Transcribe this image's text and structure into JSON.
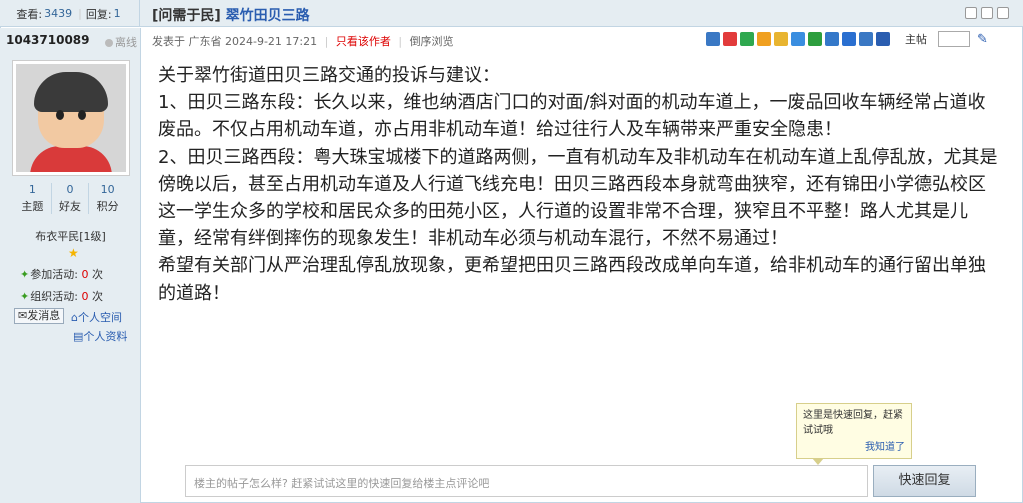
{
  "header": {
    "views_label": "查看:",
    "views": "3439",
    "replies_label": "回复:",
    "replies": "1",
    "category": "[问需于民]",
    "title": "翠竹田贝三路"
  },
  "author": {
    "name": "1043710089",
    "status": "离线",
    "posted_prefix": "发表于",
    "location": "广东省",
    "datetime": "2024-9-21 17:21",
    "only_author": "只看该作者",
    "reverse": "倒序浏览",
    "floor_label": "主帖"
  },
  "profile": {
    "stats": [
      {
        "value": "1",
        "label": "主题"
      },
      {
        "value": "0",
        "label": "好友"
      },
      {
        "value": "10",
        "label": "积分"
      }
    ],
    "rank": "布衣平民[1级]",
    "activities": [
      {
        "label": "参加活动:",
        "count": "0",
        "unit": "次"
      },
      {
        "label": "组织活动:",
        "count": "0",
        "unit": "次"
      }
    ],
    "send_msg": "发消息",
    "space": "个人空间",
    "profile_link": "个人资料"
  },
  "post": {
    "paragraphs": [
      "关于翠竹街道田贝三路交通的投诉与建议：",
      "1、田贝三路东段：长久以来，维也纳酒店门口的对面/斜对面的机动车道上，一废品回收车辆经常占道收废品。不仅占用机动车道，亦占用非机动车道！给过往行人及车辆带来严重安全隐患！",
      "2、田贝三路西段：粤大珠宝城楼下的道路两侧，一直有机动车及非机动车在机动车道上乱停乱放，尤其是傍晚以后，甚至占用机动车道及人行道飞线充电！田贝三路西段本身就弯曲狭窄，还有锦田小学德弘校区这一学生众多的学校和居民众多的田苑小区，人行道的设置非常不合理，狭窄且不平整！路人尤其是儿童，经常有绊倒摔伤的现象发生！非机动车必须与机动车混行，不然不易通过！",
      "希望有关部门从严治理乱停乱放现象，更希望把田贝三路西段改成单向车道，给非机动车的通行留出单独的道路！"
    ]
  },
  "tooltip": {
    "text": "这里是快速回复，赶紧试试哦",
    "ok": "我知道了"
  },
  "reply": {
    "placeholder": "楼主的帖子怎么样? 赶紧试试这里的快速回复给楼主点评论吧",
    "button": "快速回复"
  },
  "icons": {
    "header": [
      "print-icon",
      "prev-icon",
      "next-icon"
    ],
    "share": [
      "plus-icon",
      "weibo-icon",
      "wechat-icon",
      "qq-icon",
      "qzone-icon",
      "tencent-weibo-icon",
      "douban-icon",
      "renren-icon",
      "kaixin-icon",
      "more-icon",
      "people-icon"
    ],
    "share_colors": [
      "#3a78c4",
      "#e23b3b",
      "#2fa84f",
      "#f0a020",
      "#e8b430",
      "#3a8ee0",
      "#2d9e3e",
      "#3478c9",
      "#2a6fd0",
      "#3a78c4",
      "#2a5db0"
    ]
  }
}
